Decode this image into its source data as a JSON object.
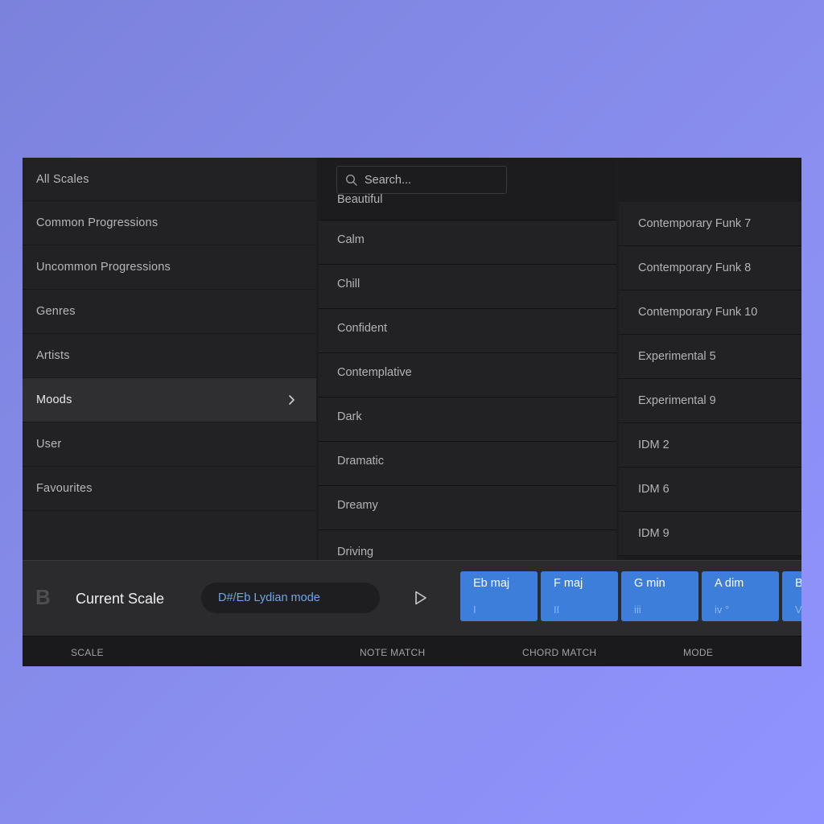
{
  "categories": [
    {
      "label": "All Scales"
    },
    {
      "label": "Common Progressions"
    },
    {
      "label": "Uncommon Progressions"
    },
    {
      "label": "Genres"
    },
    {
      "label": "Artists"
    },
    {
      "label": "Moods",
      "active": true
    },
    {
      "label": "User"
    },
    {
      "label": "Favourites"
    }
  ],
  "search": {
    "placeholder": "Search..."
  },
  "moods": [
    "Beautiful",
    "Calm",
    "Chill",
    "Confident",
    "Contemplative",
    "Dark",
    "Dramatic",
    "Dreamy",
    "Driving"
  ],
  "progressions": [
    "Contemporary Funk 7",
    "Contemporary Funk 8",
    "Contemporary Funk 10",
    "Experimental 5",
    "Experimental 9",
    "IDM 2",
    "IDM 6",
    "IDM 9"
  ],
  "scale_panel": {
    "letter": "B",
    "title": "Current Scale",
    "selected_scale": "D#/Eb Lydian mode"
  },
  "chords": [
    {
      "name": "Eb maj",
      "degree": "I"
    },
    {
      "name": "F maj",
      "degree": "II"
    },
    {
      "name": "G min",
      "degree": "iii"
    },
    {
      "name": "A dim",
      "degree": "iv °"
    },
    {
      "name": "B",
      "degree": "V"
    }
  ],
  "table_headers": {
    "scale": "SCALE",
    "note_match": "NOTE MATCH",
    "chord_match": "CHORD MATCH",
    "mode": "MODE"
  },
  "colors": {
    "accent": "#3d7edb",
    "selected_text": "#6fa6f0",
    "background_gradient_start": "#7b82dc",
    "background_gradient_end": "#9092ff"
  }
}
